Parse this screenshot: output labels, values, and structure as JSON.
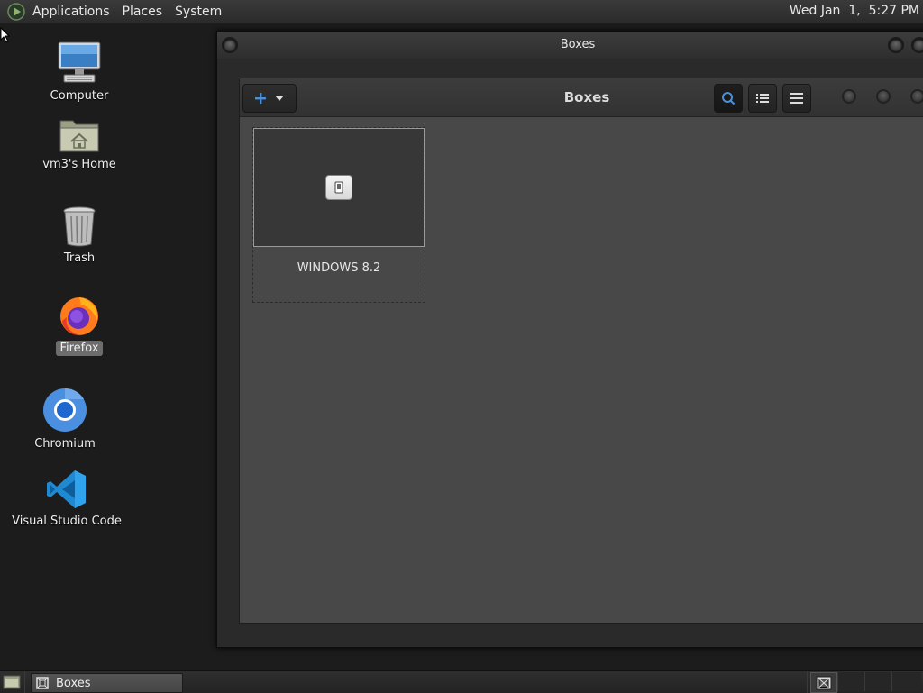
{
  "top_panel": {
    "menus": [
      "Applications",
      "Places",
      "System"
    ],
    "clock": "Wed Jan  1,  5:27 PM"
  },
  "desktop": {
    "icons": [
      {
        "label": "Computer",
        "icon": "computer-icon"
      },
      {
        "label": "vm3's Home",
        "icon": "home-folder-icon"
      },
      {
        "label": "Trash",
        "icon": "trash-icon"
      },
      {
        "label": "Firefox",
        "icon": "firefox-icon"
      },
      {
        "label": "Chromium",
        "icon": "chromium-icon"
      },
      {
        "label": "Visual Studio Code",
        "icon": "vscode-icon"
      }
    ]
  },
  "outer_window": {
    "title": "Boxes"
  },
  "boxes_app": {
    "title": "Boxes",
    "items": [
      {
        "name": "WINDOWS 8.2"
      }
    ]
  },
  "taskbar": {
    "tasks": [
      {
        "label": "Boxes"
      }
    ]
  },
  "colors": {
    "accent": "#4a90d9"
  }
}
